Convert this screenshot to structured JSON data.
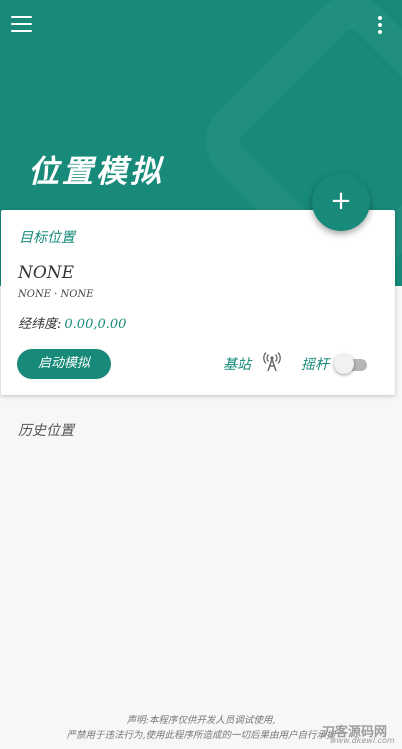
{
  "header": {
    "title": "位置模拟",
    "menu_icon": "menu-icon",
    "more_icon": "more-vert-icon",
    "color": "#178a79"
  },
  "fab": {
    "label": "+",
    "icon": "add-icon"
  },
  "target_card": {
    "title": "目标位置",
    "location_name": "NONE",
    "location_detail": "NONE · NONE",
    "coords_label": "经纬度:",
    "coords_value": "0.00,0.00",
    "start_button": "启动模拟",
    "station_label": "基站",
    "station_icon": "antenna-icon",
    "joystick_label": "摇杆",
    "joystick_enabled": false
  },
  "history": {
    "label": "历史位置"
  },
  "footer": {
    "line1": "声明:本程序仅供开发人员调试使用,",
    "line2": "严禁用于违法行为,使用此程序所造成的一切后果由用户自行承担"
  },
  "watermark": {
    "text": "刀客源码网",
    "url": "www.dkewl.com"
  }
}
